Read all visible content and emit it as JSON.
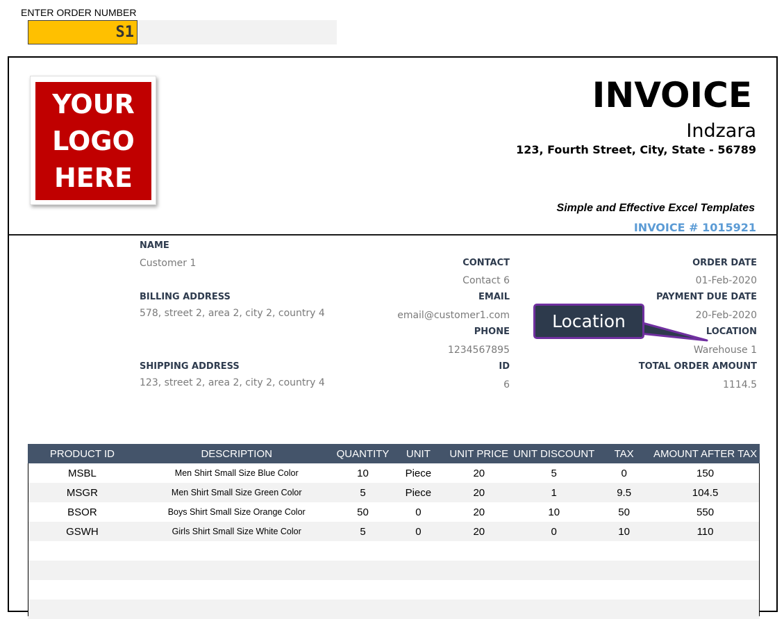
{
  "order_entry": {
    "label": "ENTER ORDER NUMBER",
    "value": "S1"
  },
  "logo": {
    "lines": [
      "YOUR",
      "LOGO",
      "HERE"
    ]
  },
  "header": {
    "title": "INVOICE",
    "company_name": "Indzara",
    "company_address": "123, Fourth Street, City, State - 56789",
    "tagline": "Simple and Effective Excel Templates",
    "invoice_number": "INVOICE # 1015921"
  },
  "customer": {
    "name_label": "NAME",
    "name": "Customer 1",
    "billing_label": "BILLING ADDRESS",
    "billing_address": "578, street 2, area 2, city 2, country 4",
    "shipping_label": "SHIPPING ADDRESS",
    "shipping_address": "123, street 2, area 2, city 2, country 4"
  },
  "contact": {
    "contact_label": "CONTACT",
    "contact": "Contact 6",
    "email_label": "EMAIL",
    "email": "email@customer1.com",
    "phone_label": "PHONE",
    "phone": "1234567895",
    "id_label": "ID",
    "id": "6"
  },
  "order": {
    "order_date_label": "ORDER DATE",
    "order_date": "01-Feb-2020",
    "due_date_label": "PAYMENT DUE DATE",
    "due_date": "20-Feb-2020",
    "location_label": "LOCATION",
    "location": "Warehouse 1",
    "total_label": "TOTAL ORDER AMOUNT",
    "total": "1114.5"
  },
  "callout": {
    "text": "Location",
    "border_color": "#7030a0",
    "fill_color": "#2d3a4c"
  },
  "table": {
    "headers": [
      "PRODUCT ID",
      "DESCRIPTION",
      "QUANTITY",
      "UNIT",
      "UNIT PRICE",
      "UNIT DISCOUNT",
      "TAX",
      "AMOUNT AFTER TAX"
    ],
    "rows": [
      [
        "MSBL",
        "Men Shirt Small Size Blue Color",
        "10",
        "Piece",
        "20",
        "5",
        "0",
        "150"
      ],
      [
        "MSGR",
        "Men Shirt Small Size Green Color",
        "5",
        "Piece",
        "20",
        "1",
        "9.5",
        "104.5"
      ],
      [
        "BSOR",
        "Boys Shirt Small Size Orange Color",
        "50",
        "0",
        "20",
        "10",
        "50",
        "550"
      ],
      [
        "GSWH",
        "Girls Shirt Small Size White Color",
        "5",
        "0",
        "20",
        "0",
        "10",
        "110"
      ],
      [
        "",
        "",
        "",
        "",
        "",
        "",
        "",
        ""
      ],
      [
        "",
        "",
        "",
        "",
        "",
        "",
        "",
        ""
      ],
      [
        "",
        "",
        "",
        "",
        "",
        "",
        "",
        ""
      ],
      [
        "",
        "",
        "",
        "",
        "",
        "",
        "",
        ""
      ]
    ]
  },
  "colors": {
    "order_input_fill": "#ffc000",
    "logo_fill": "#c00000",
    "table_header_fill": "#44546a",
    "invoice_number_color": "#5b9bd5"
  }
}
